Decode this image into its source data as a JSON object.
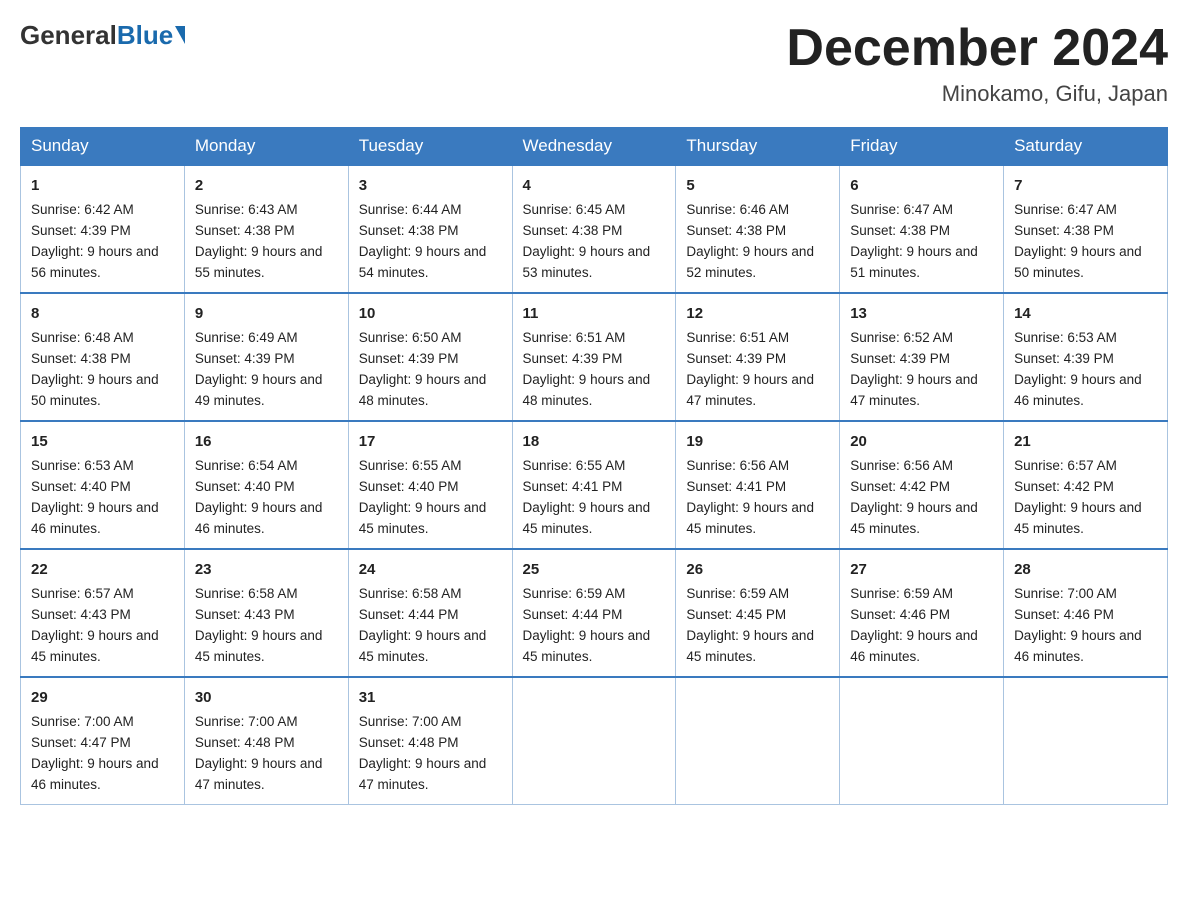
{
  "logo": {
    "general": "General",
    "blue": "Blue"
  },
  "title": "December 2024",
  "location": "Minokamo, Gifu, Japan",
  "days_of_week": [
    "Sunday",
    "Monday",
    "Tuesday",
    "Wednesday",
    "Thursday",
    "Friday",
    "Saturday"
  ],
  "weeks": [
    [
      {
        "day": "1",
        "sunrise": "6:42 AM",
        "sunset": "4:39 PM",
        "daylight": "9 hours and 56 minutes."
      },
      {
        "day": "2",
        "sunrise": "6:43 AM",
        "sunset": "4:38 PM",
        "daylight": "9 hours and 55 minutes."
      },
      {
        "day": "3",
        "sunrise": "6:44 AM",
        "sunset": "4:38 PM",
        "daylight": "9 hours and 54 minutes."
      },
      {
        "day": "4",
        "sunrise": "6:45 AM",
        "sunset": "4:38 PM",
        "daylight": "9 hours and 53 minutes."
      },
      {
        "day": "5",
        "sunrise": "6:46 AM",
        "sunset": "4:38 PM",
        "daylight": "9 hours and 52 minutes."
      },
      {
        "day": "6",
        "sunrise": "6:47 AM",
        "sunset": "4:38 PM",
        "daylight": "9 hours and 51 minutes."
      },
      {
        "day": "7",
        "sunrise": "6:47 AM",
        "sunset": "4:38 PM",
        "daylight": "9 hours and 50 minutes."
      }
    ],
    [
      {
        "day": "8",
        "sunrise": "6:48 AM",
        "sunset": "4:38 PM",
        "daylight": "9 hours and 50 minutes."
      },
      {
        "day": "9",
        "sunrise": "6:49 AM",
        "sunset": "4:39 PM",
        "daylight": "9 hours and 49 minutes."
      },
      {
        "day": "10",
        "sunrise": "6:50 AM",
        "sunset": "4:39 PM",
        "daylight": "9 hours and 48 minutes."
      },
      {
        "day": "11",
        "sunrise": "6:51 AM",
        "sunset": "4:39 PM",
        "daylight": "9 hours and 48 minutes."
      },
      {
        "day": "12",
        "sunrise": "6:51 AM",
        "sunset": "4:39 PM",
        "daylight": "9 hours and 47 minutes."
      },
      {
        "day": "13",
        "sunrise": "6:52 AM",
        "sunset": "4:39 PM",
        "daylight": "9 hours and 47 minutes."
      },
      {
        "day": "14",
        "sunrise": "6:53 AM",
        "sunset": "4:39 PM",
        "daylight": "9 hours and 46 minutes."
      }
    ],
    [
      {
        "day": "15",
        "sunrise": "6:53 AM",
        "sunset": "4:40 PM",
        "daylight": "9 hours and 46 minutes."
      },
      {
        "day": "16",
        "sunrise": "6:54 AM",
        "sunset": "4:40 PM",
        "daylight": "9 hours and 46 minutes."
      },
      {
        "day": "17",
        "sunrise": "6:55 AM",
        "sunset": "4:40 PM",
        "daylight": "9 hours and 45 minutes."
      },
      {
        "day": "18",
        "sunrise": "6:55 AM",
        "sunset": "4:41 PM",
        "daylight": "9 hours and 45 minutes."
      },
      {
        "day": "19",
        "sunrise": "6:56 AM",
        "sunset": "4:41 PM",
        "daylight": "9 hours and 45 minutes."
      },
      {
        "day": "20",
        "sunrise": "6:56 AM",
        "sunset": "4:42 PM",
        "daylight": "9 hours and 45 minutes."
      },
      {
        "day": "21",
        "sunrise": "6:57 AM",
        "sunset": "4:42 PM",
        "daylight": "9 hours and 45 minutes."
      }
    ],
    [
      {
        "day": "22",
        "sunrise": "6:57 AM",
        "sunset": "4:43 PM",
        "daylight": "9 hours and 45 minutes."
      },
      {
        "day": "23",
        "sunrise": "6:58 AM",
        "sunset": "4:43 PM",
        "daylight": "9 hours and 45 minutes."
      },
      {
        "day": "24",
        "sunrise": "6:58 AM",
        "sunset": "4:44 PM",
        "daylight": "9 hours and 45 minutes."
      },
      {
        "day": "25",
        "sunrise": "6:59 AM",
        "sunset": "4:44 PM",
        "daylight": "9 hours and 45 minutes."
      },
      {
        "day": "26",
        "sunrise": "6:59 AM",
        "sunset": "4:45 PM",
        "daylight": "9 hours and 45 minutes."
      },
      {
        "day": "27",
        "sunrise": "6:59 AM",
        "sunset": "4:46 PM",
        "daylight": "9 hours and 46 minutes."
      },
      {
        "day": "28",
        "sunrise": "7:00 AM",
        "sunset": "4:46 PM",
        "daylight": "9 hours and 46 minutes."
      }
    ],
    [
      {
        "day": "29",
        "sunrise": "7:00 AM",
        "sunset": "4:47 PM",
        "daylight": "9 hours and 46 minutes."
      },
      {
        "day": "30",
        "sunrise": "7:00 AM",
        "sunset": "4:48 PM",
        "daylight": "9 hours and 47 minutes."
      },
      {
        "day": "31",
        "sunrise": "7:00 AM",
        "sunset": "4:48 PM",
        "daylight": "9 hours and 47 minutes."
      },
      null,
      null,
      null,
      null
    ]
  ],
  "labels": {
    "sunrise": "Sunrise:",
    "sunset": "Sunset:",
    "daylight": "Daylight:"
  }
}
